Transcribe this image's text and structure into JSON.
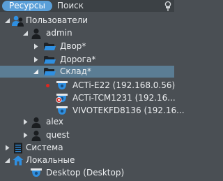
{
  "tabs": [
    {
      "label": "Ресурсы",
      "active": true
    },
    {
      "label": "Поиск",
      "active": false
    }
  ],
  "tree": {
    "users": "Пользователи",
    "admin": "admin",
    "dvor": "Двор*",
    "doroga": "Дорога*",
    "sklad": "Склад*",
    "cam1": "ACTi-E22 (192.168.0.56)",
    "cam2": "ACTi-TCM1231 (192.16...",
    "cam3": "VIVOTEKFD8136 (192.16...",
    "alex": "alex",
    "quest": "quest",
    "system": "Система",
    "local": "Локальные",
    "desktop": "Desktop (Desktop)"
  },
  "colors": {
    "background": "#4a4f54",
    "tab_active": "#5a9fd8",
    "selection": "#5b7d94",
    "accent_blue": "#2f8fe0",
    "recording_red": "#e0261f"
  }
}
